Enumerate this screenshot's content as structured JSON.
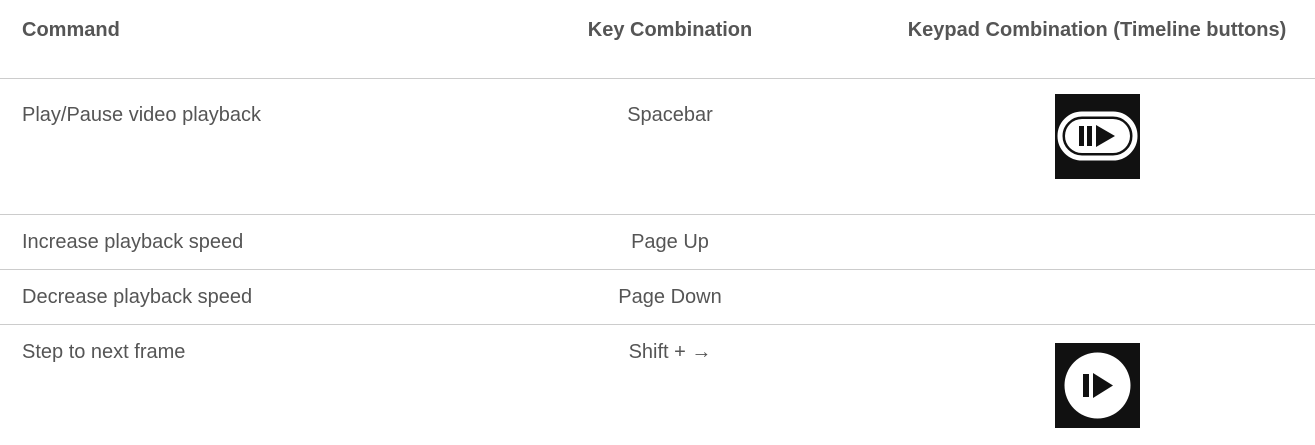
{
  "table": {
    "headers": {
      "command": "Command",
      "key_combination": "Key Combination",
      "keypad_combination": "Keypad Combination (Timeline buttons)"
    },
    "rows": [
      {
        "command": "Play/Pause video playback",
        "key": "Spacebar",
        "keypad_icon": "play-pause-icon"
      },
      {
        "command": "Increase playback speed",
        "key": "Page Up",
        "keypad_icon": ""
      },
      {
        "command": "Decrease playback speed",
        "key": "Page Down",
        "keypad_icon": ""
      },
      {
        "command": "Step to next frame",
        "key": "Shift + →",
        "keypad_icon": "step-forward-icon"
      }
    ]
  },
  "colors": {
    "text": "#555555",
    "divider": "#cccccc",
    "icon_background": "#111111",
    "icon_pill": "#ffffff"
  }
}
